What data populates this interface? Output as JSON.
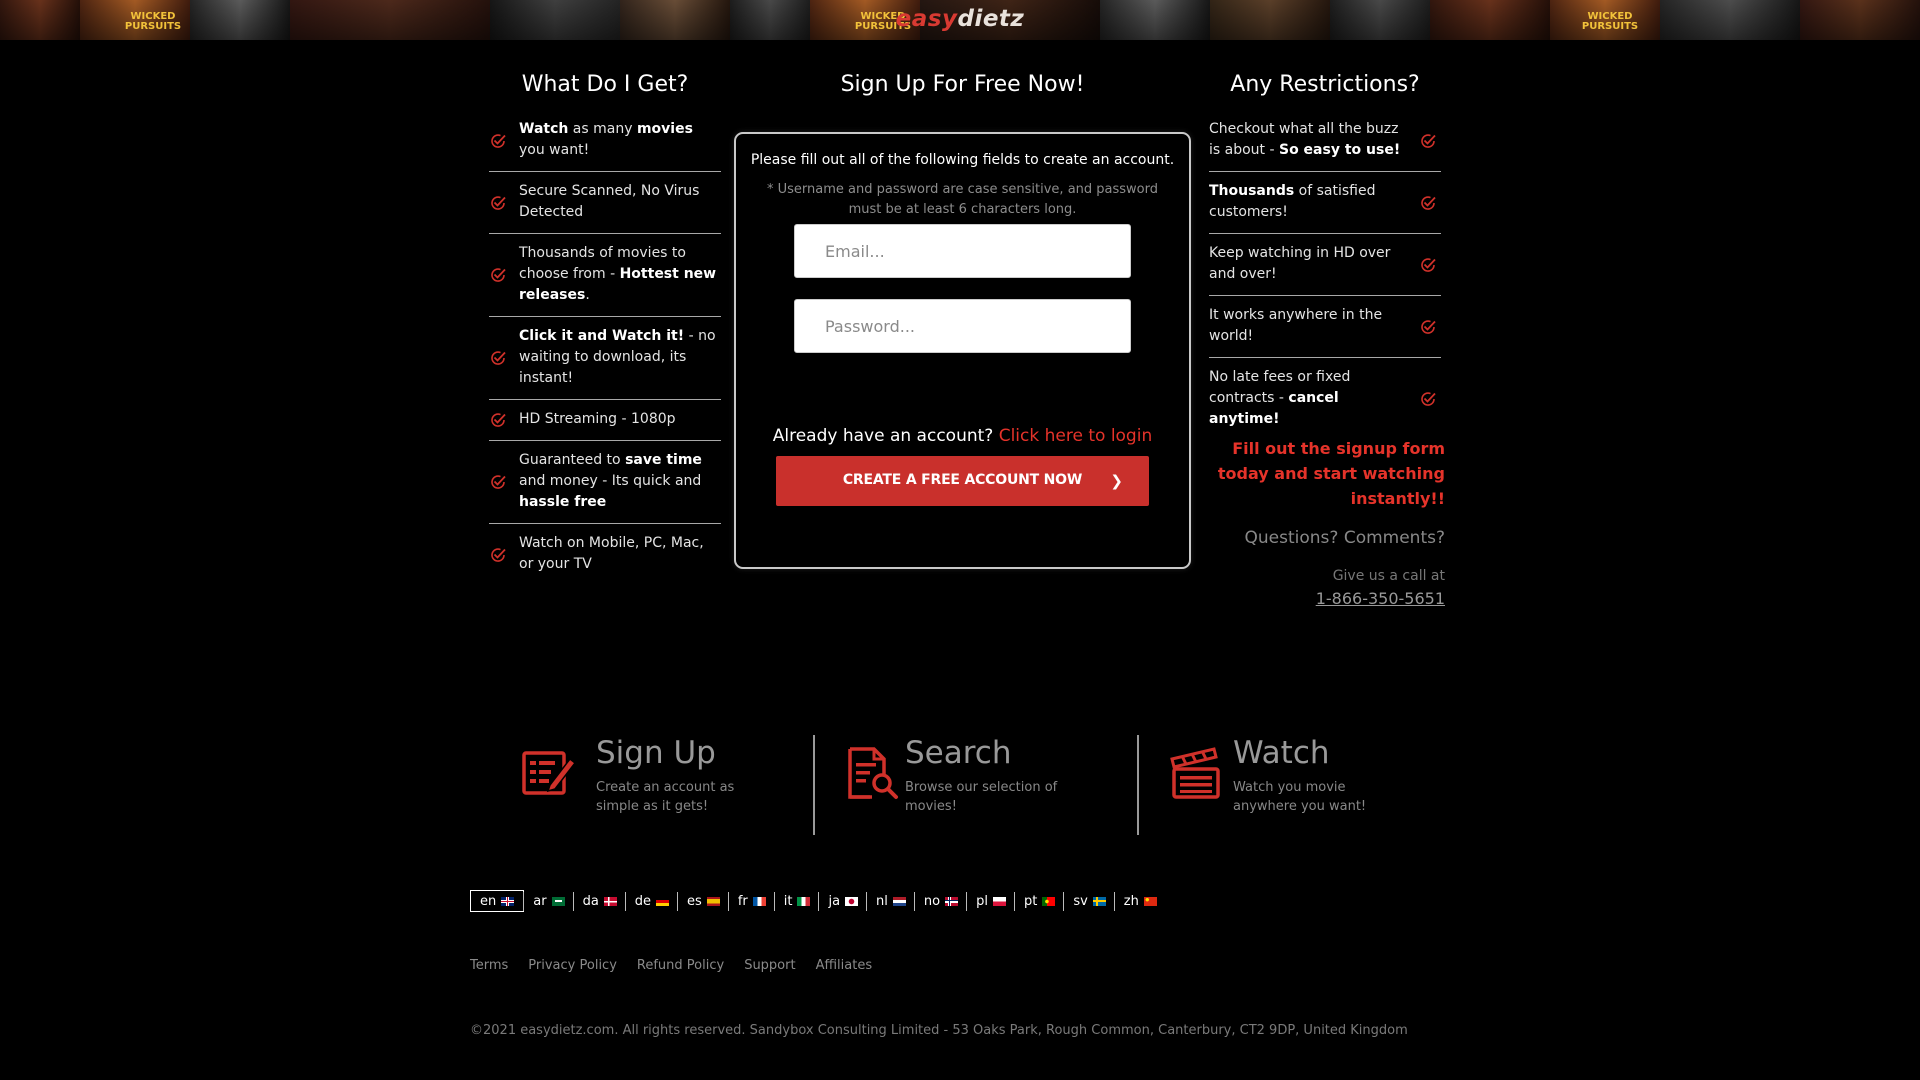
{
  "header": {
    "logo": {
      "part1": "easy",
      "part2": "dietz"
    },
    "banner_text_1": "WICKED PURSUITS",
    "banner_text_2": "WICKED PURSUITS",
    "banner_text_3": "WICKED PURSUITS"
  },
  "left": {
    "title": "What Do I Get?",
    "items": [
      [
        "Watch",
        " as many ",
        "movies",
        " you want!"
      ],
      [
        "Secure Scanned, No Virus Detected"
      ],
      [
        "Thousands of movies to choose from - ",
        "Hottest new releases",
        "."
      ],
      [
        "Click it and Watch it!",
        " - no waiting to download, its instant!"
      ],
      [
        "HD Streaming - 1080p"
      ],
      [
        "Guaranteed to ",
        "save time",
        " and money - Its quick and ",
        "hassle free"
      ],
      [
        "Watch on Mobile, PC, Mac, or your TV"
      ]
    ]
  },
  "center": {
    "title": "Sign Up For Free Now!",
    "intro": "Please fill out all of the following fields to create an account.",
    "note": "* Username and password are case sensitive, and password must be at least 6 characters long.",
    "email_placeholder": "Email...",
    "password_placeholder": "Password...",
    "already_text": "Already have an account? ",
    "login_link": "Click here to login",
    "create_button": "CREATE A FREE ACCOUNT NOW"
  },
  "right": {
    "title": "Any Restrictions?",
    "items": [
      [
        "Checkout what all the buzz is about - ",
        "So easy to use!"
      ],
      [
        "Thousands",
        " of satisfied customers!"
      ],
      [
        "Keep watching in HD over and over!"
      ],
      [
        "It works anywhere in the world!"
      ],
      [
        "No late fees or fixed contracts - ",
        "cancel anytime!"
      ]
    ],
    "cta": "Fill out the signup form today and start watching instantly!!",
    "questions": "Questions? Comments?",
    "call": "Give us a call at",
    "phone": "1-866-350-5651"
  },
  "steps": [
    {
      "title": "Sign Up",
      "desc": "Create an account as simple as it gets!",
      "icon": "signup-form-icon"
    },
    {
      "title": "Search",
      "desc": "Browse our selection of movies!",
      "icon": "search-document-icon"
    },
    {
      "title": "Watch",
      "desc": "Watch you movie anywhere you want!",
      "icon": "clapperboard-icon"
    }
  ],
  "languages": [
    {
      "code": "en",
      "active": true
    },
    {
      "code": "ar"
    },
    {
      "code": "da"
    },
    {
      "code": "de"
    },
    {
      "code": "es"
    },
    {
      "code": "fr"
    },
    {
      "code": "it"
    },
    {
      "code": "ja"
    },
    {
      "code": "nl"
    },
    {
      "code": "no"
    },
    {
      "code": "pl"
    },
    {
      "code": "pt"
    },
    {
      "code": "sv"
    },
    {
      "code": "zh"
    }
  ],
  "footer": {
    "links": [
      "Terms",
      "Privacy Policy",
      "Refund Policy",
      "Support",
      "Affiliates"
    ],
    "copyright": "©2021 easydietz.com. All rights reserved. Sandybox Consulting Limited - 53 Oaks Park, Rough Common, Canterbury, CT2 9DP, United Kingdom"
  },
  "colors": {
    "accent": "#e5332a",
    "button": "#c9302c",
    "background": "#000000"
  }
}
